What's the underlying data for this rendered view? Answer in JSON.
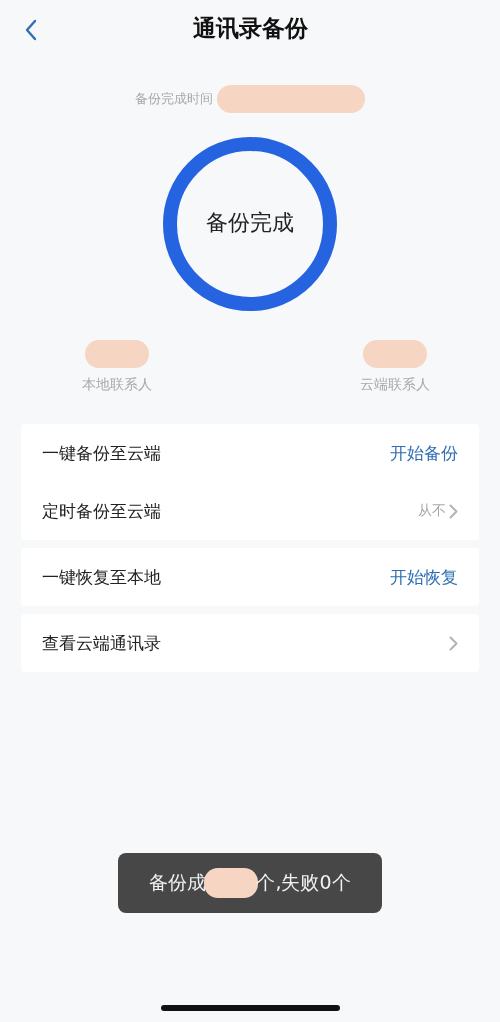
{
  "header": {
    "title": "通讯录备份"
  },
  "backup_time": {
    "label": "备份完成时间",
    "redacted": true
  },
  "ring": {
    "label": "备份完成",
    "level": 1
  },
  "stats": [
    {
      "label": "本地联系人",
      "redacted": true
    },
    {
      "label": "云端联系人",
      "redacted": true
    }
  ],
  "groups": [
    {
      "rows": [
        {
          "label": "一键备份至云端",
          "kind": "action",
          "value": "开始备份"
        },
        {
          "label": "定时备份至云端",
          "kind": "value",
          "value": "从不"
        }
      ]
    },
    {
      "rows": [
        {
          "label": "一键恢复至本地",
          "kind": "action",
          "value": "开始恢复"
        }
      ]
    },
    {
      "rows": [
        {
          "label": "查看云端通讯录",
          "kind": "link"
        }
      ]
    }
  ],
  "toast": {
    "before": "备份成",
    "after": "个,失败0个",
    "redacted": true
  }
}
